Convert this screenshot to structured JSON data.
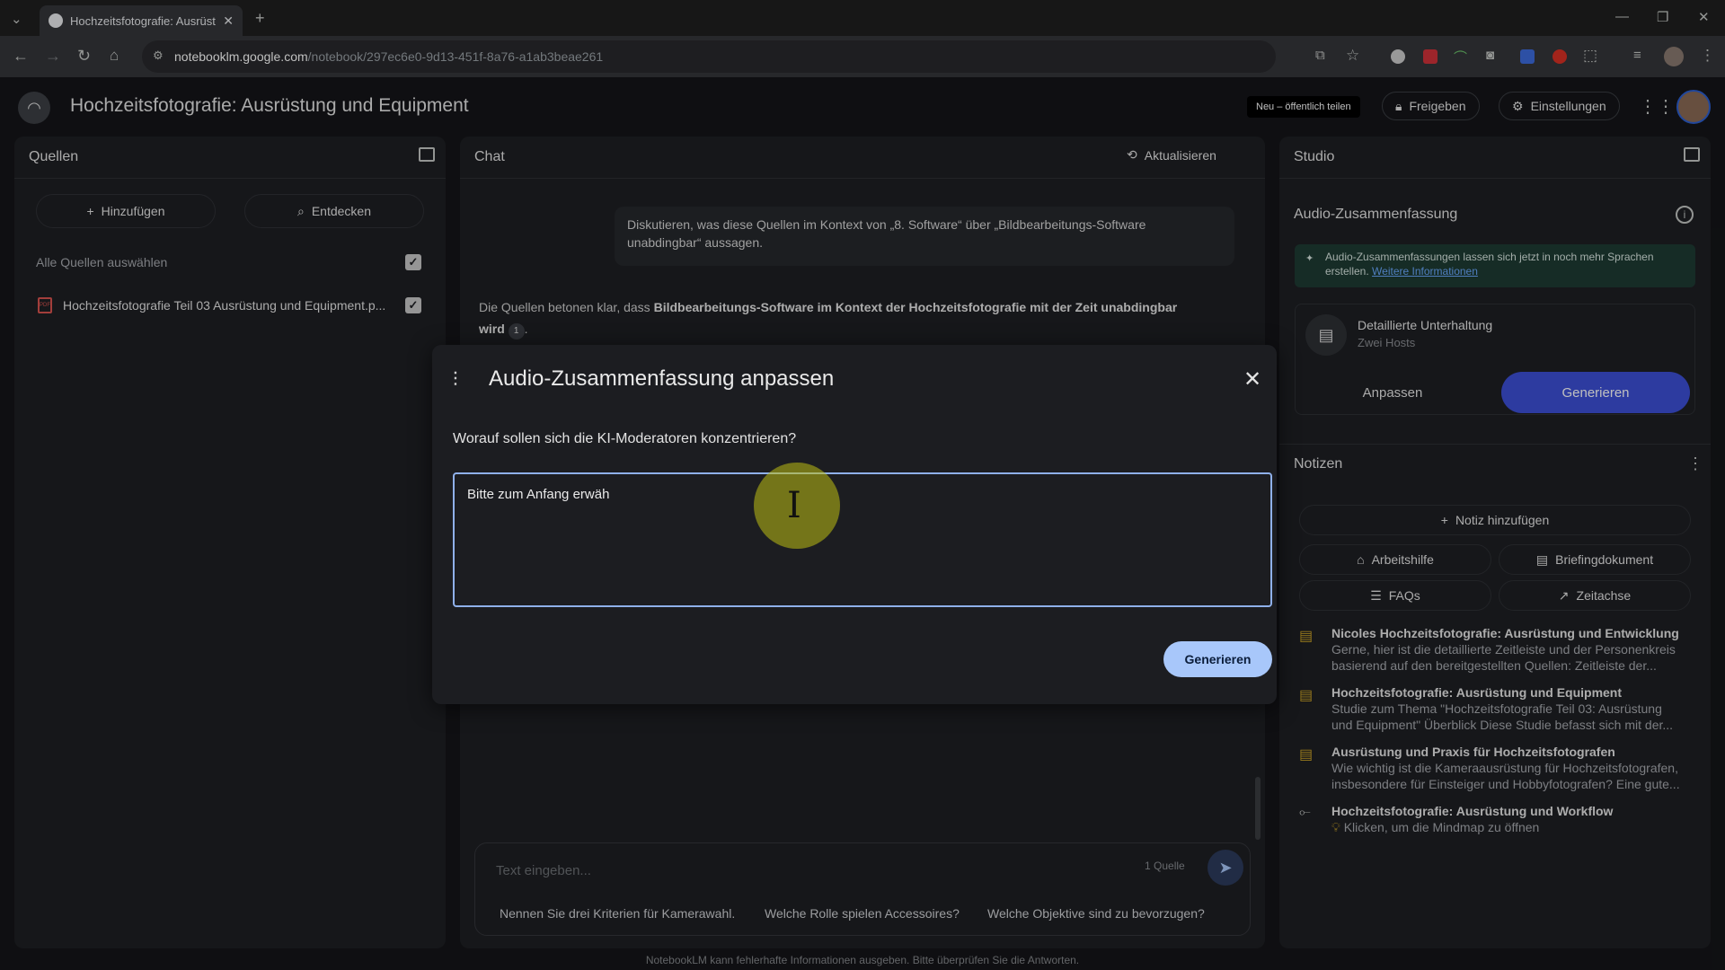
{
  "browser": {
    "tab_title": "Hochzeitsfotografie: Ausrüstun",
    "url_host": "notebooklm.google.com",
    "url_path": "/notebook/297ec6e0-9d13-451f-8a76-a1ab3beae261"
  },
  "header": {
    "title": "Hochzeitsfotografie: Ausrüstung und Equipment",
    "new_share_badge": "Neu – öffentlich teilen",
    "share_label": "Freigeben",
    "settings_label": "Einstellungen"
  },
  "sources": {
    "title": "Quellen",
    "add_label": "Hinzufügen",
    "discover_label": "Entdecken",
    "select_all_label": "Alle Quellen auswählen",
    "items": [
      {
        "label": "Hochzeitsfotografie Teil 03 Ausrüstung und Equipment.p...",
        "icon": "pdf-icon"
      }
    ]
  },
  "chat": {
    "title": "Chat",
    "refresh_label": "Aktualisieren",
    "user_message": "Diskutieren, was diese Quellen im Kontext von „8. Software“ über „Bildbearbeitungs-Software unabdingbar“ aussagen.",
    "answer_prefix": "Die Quellen betonen klar, dass ",
    "answer_bold": "Bildbearbeitungs-Software im Kontext der Hochzeitsfotografie mit der Zeit unabdingbar wird",
    "answer_citation": "1",
    "answer_suffix": ".",
    "input_placeholder": "Text eingeben...",
    "source_count": "1 Quelle",
    "suggestions": [
      "Nennen Sie drei Kriterien für Kamerawahl.",
      "Welche Rolle spielen Accessoires?",
      "Welche Objektive sind zu bevorzugen?"
    ],
    "disclaimer": "NotebookLM kann fehlerhafte Informationen ausgeben. Bitte überprüfen Sie die Antworten."
  },
  "modal": {
    "title": "Audio-Zusammenfassung anpassen",
    "question": "Worauf sollen sich die KI-Moderatoren konzentrieren?",
    "textarea_value": "Bitte zum Anfang erwäh",
    "generate_label": "Generieren"
  },
  "studio": {
    "title": "Studio",
    "audio_section_title": "Audio-Zusammenfassung",
    "info_text": "Audio-Zusammenfassungen lassen sich jetzt in noch mehr Sprachen erstellen.",
    "info_link": "Weitere Informationen",
    "conversation_title": "Detaillierte Unterhaltung",
    "conversation_subtitle": "Zwei Hosts",
    "customize_label": "Anpassen",
    "generate_label": "Generieren",
    "notes_title": "Notizen",
    "add_note_label": "Notiz hinzufügen",
    "tools": [
      "Arbeitshilfe",
      "Briefingdokument",
      "FAQs",
      "Zeitachse"
    ],
    "notes": [
      {
        "title": "Nicoles Hochzeitsfotografie: Ausrüstung und Entwicklung",
        "preview1": "Gerne, hier ist die detaillierte Zeitleiste und der Personenkreis",
        "preview2": "basierend auf den bereitgestellten Quellen: Zeitleiste der...",
        "icon": "note-icon"
      },
      {
        "title": "Hochzeitsfotografie: Ausrüstung und Equipment",
        "preview1": "Studie zum Thema \"Hochzeitsfotografie Teil 03: Ausrüstung",
        "preview2": "und Equipment\" Überblick Diese Studie befasst sich mit der...",
        "icon": "note-icon"
      },
      {
        "title": "Ausrüstung und Praxis für Hochzeitsfotografen",
        "preview1": "Wie wichtig ist die Kameraausrüstung für Hochzeitsfotografen,",
        "preview2": "insbesondere für Einsteiger und Hobbyfotografen? Eine gute...",
        "icon": "note-icon"
      },
      {
        "title": "Hochzeitsfotografie: Ausrüstung und Workflow",
        "preview1": "Klicken, um die Mindmap zu öffnen",
        "preview2": "",
        "icon": "mindmap-icon"
      }
    ]
  },
  "colors": {
    "accent": "#3c4fd6",
    "modal_button": "#a8c7fa",
    "info_bg": "#1e3b33",
    "note_icon": "#c9a227"
  }
}
